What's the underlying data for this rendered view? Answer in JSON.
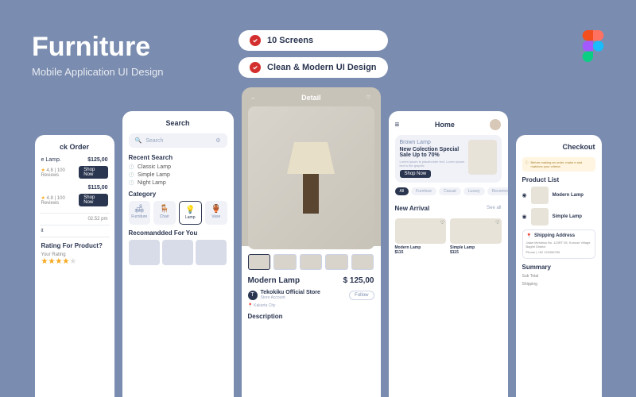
{
  "hero": {
    "title": "Furniture",
    "subtitle": "Mobile Application UI Design"
  },
  "badges": [
    {
      "text": "10 Screens"
    },
    {
      "text": "Clean & Modern UI Design"
    }
  ],
  "screen1": {
    "title": "ck Order",
    "item1": {
      "name": "e Lamp.",
      "price": "$125,00",
      "rating": "4.8 | 100 Reviews"
    },
    "item2": {
      "name": "",
      "price": "$115,00",
      "rating": "4.8 | 100 Reviews"
    },
    "time1": "02.52 pm",
    "time2": "it",
    "ratingQ": "Rating For Product?",
    "yourRating": "Your Rating"
  },
  "screen2": {
    "title": "Search",
    "searchPlaceholder": "Search",
    "recentH": "Recent Search",
    "recent": [
      "Classic Lamp",
      "Simple Lamp",
      "Night Lamp"
    ],
    "catH": "Category",
    "categories": [
      {
        "label": "Furniture",
        "icon": "🛋"
      },
      {
        "label": "Chair",
        "icon": "🪑"
      },
      {
        "label": "Lamp",
        "icon": "💡"
      },
      {
        "label": "Vase",
        "icon": "🏺"
      }
    ],
    "recoH": "Recomandded For You"
  },
  "screen3": {
    "title": "Detail",
    "productName": "Modern Lamp",
    "price": "$ 125,00",
    "storeName": "Tekokiku Official Store",
    "storeSub": "Store Account",
    "storeLoc": "Kakarta City",
    "follow": "Follow",
    "descH": "Description"
  },
  "screen4": {
    "title": "Home",
    "bannerTitle": "Brown Lamp",
    "bannerHead": "New Colection Special Sale Up to 70%",
    "bannerSub": "Lorem ipsum is placeholder text. Lorem ipsum text is the graphic",
    "shopNow": "Shop Now",
    "pills": [
      "All",
      "Furniture",
      "Casual",
      "Luxury",
      "Recommend"
    ],
    "newArrival": "New Arrival",
    "seeAll": "See all",
    "prod1": {
      "name": "Modern Lamp",
      "price": "$115"
    },
    "prod2": {
      "name": "Simple Lamp",
      "price": "$115"
    }
  },
  "screen5": {
    "title": "Checkout",
    "alert": "Before making an order, make e and matches your criteria",
    "listH": "Product List",
    "item1": "Modern Lamp",
    "item2": "Simple Lamp",
    "shipH": "Shipping Address",
    "addr": "Jalan Merdeka No. 123RT 05, Koncoe Village Baghri District",
    "phone": "Phone | +62 123456789",
    "summaryH": "Summary",
    "subTotal": "Sub Total",
    "shipping": "Shipping"
  }
}
